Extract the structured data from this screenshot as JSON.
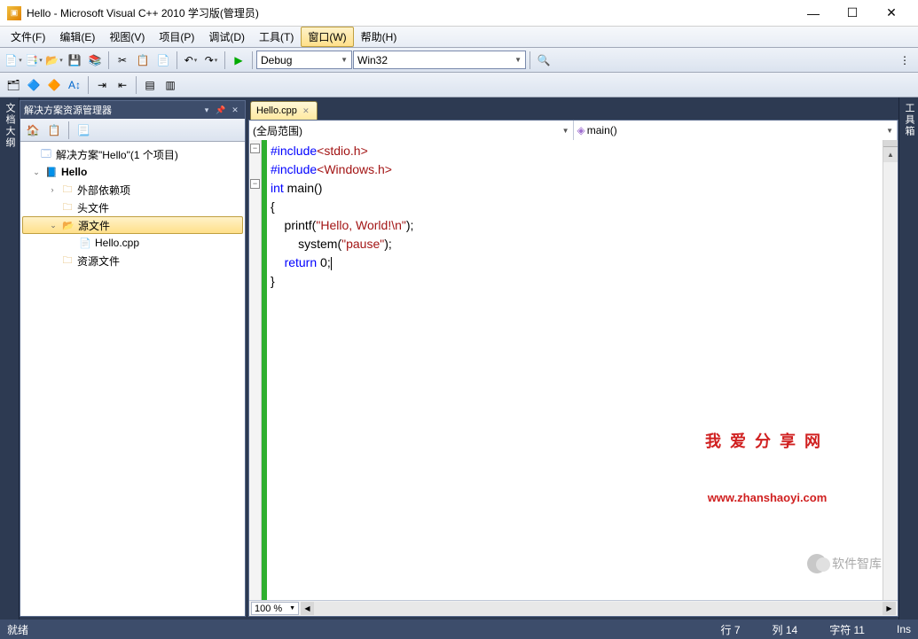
{
  "title": "Hello - Microsoft Visual C++ 2010 学习版(管理员)",
  "menu": {
    "file": "文件(F)",
    "edit": "编辑(E)",
    "view": "视图(V)",
    "project": "项目(P)",
    "debug": "调试(D)",
    "tools": "工具(T)",
    "window": "窗口(W)",
    "help": "帮助(H)"
  },
  "toolbar": {
    "config": "Debug",
    "platform": "Win32"
  },
  "leftStripLabel": "文档大纲",
  "rightStripLabel": "工具箱",
  "solutionPanel": {
    "title": "解决方案资源管理器",
    "root": "解决方案\"Hello\"(1 个项目)",
    "project": "Hello",
    "externalDeps": "外部依赖项",
    "headers": "头文件",
    "sources": "源文件",
    "sourceFile": "Hello.cpp",
    "resources": "资源文件"
  },
  "editor": {
    "tab": "Hello.cpp",
    "scopeLeft": "(全局范围)",
    "scopeRight": "main()",
    "zoom": "100 %",
    "code": {
      "l1a": "#include",
      "l1b": "<stdio.h>",
      "l2a": "#include",
      "l2b": "<Windows.h>",
      "l3a": "int",
      "l3b": " main()",
      "l4": "{",
      "l5a": "    printf(",
      "l5b": "\"Hello, World!\\n\"",
      "l5c": ");",
      "l6a": "        system(",
      "l6b": "\"pause\"",
      "l6c": ");",
      "l7a": "    ",
      "l7b": "return",
      "l7c": " 0;",
      "l8": "}"
    }
  },
  "watermark": {
    "l1": "我爱分享网",
    "l2": "www.zhanshaoyi.com"
  },
  "chatstamp": "软件智库",
  "status": {
    "ready": "就绪",
    "line": "行 7",
    "col": "列 14",
    "char": "字符 11",
    "ins": "Ins"
  }
}
